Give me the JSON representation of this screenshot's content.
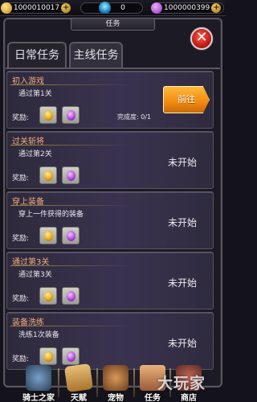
{
  "resources": {
    "gold": "1000010017",
    "diamond": "0",
    "gems": "1000000399",
    "add_symbol": "+"
  },
  "window": {
    "title": "任务",
    "close_symbol": "✕"
  },
  "tabs": [
    {
      "label": "日常任务",
      "active": false
    },
    {
      "label": "主线任务",
      "active": true
    }
  ],
  "reward_label": "奖励:",
  "quests": [
    {
      "title": "初入游戏",
      "desc": "通过第1关",
      "progress": "完成度: 0/1",
      "action": "前往",
      "status": ""
    },
    {
      "title": "过关斩将",
      "desc": "通过第2关",
      "progress": "",
      "action": "",
      "status": "未开始"
    },
    {
      "title": "穿上装备",
      "desc": "穿上一件获得的装备",
      "progress": "",
      "action": "",
      "status": "未开始"
    },
    {
      "title": "通过第3关",
      "desc": "通过第3关",
      "progress": "",
      "action": "",
      "status": "未开始"
    },
    {
      "title": "装备洗练",
      "desc": "洗练1次装备",
      "progress": "",
      "action": "",
      "status": "未开始"
    }
  ],
  "bottom_nav": [
    {
      "label": "骑士之家",
      "icon": "knight-home-icon"
    },
    {
      "label": "天赋",
      "icon": "talent-book-icon"
    },
    {
      "label": "宠物",
      "icon": "pet-icon"
    },
    {
      "label": "任务",
      "icon": "quest-scroll-icon"
    },
    {
      "label": "商店",
      "icon": "shop-icon"
    }
  ],
  "watermark": "大玩家",
  "colors": {
    "quest_title": "#f3ad7e",
    "go_button": "#f28a10",
    "close_button": "#d82a20"
  }
}
